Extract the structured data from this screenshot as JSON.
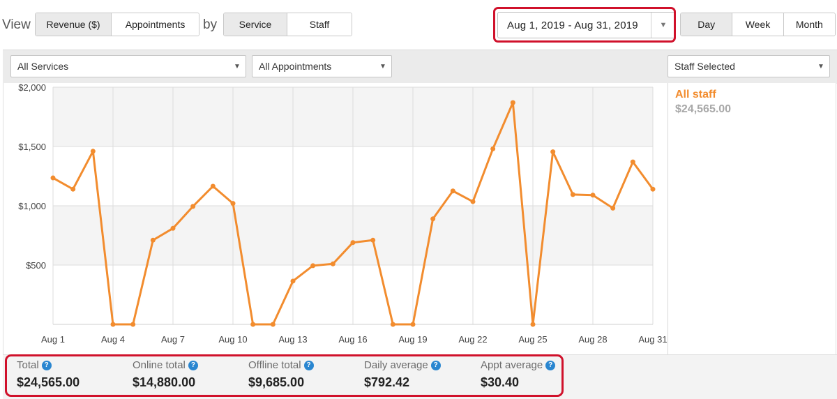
{
  "toolbar": {
    "view_label": "View",
    "by_label": "by",
    "metric_buttons": [
      "Revenue ($)",
      "Appointments"
    ],
    "group_buttons": [
      "Service",
      "Staff"
    ],
    "date_range": "Aug 1, 2019 - Aug 31, 2019",
    "period_buttons": [
      "Day",
      "Week",
      "Month"
    ]
  },
  "filters": {
    "services": "All Services",
    "appointments": "All Appointments",
    "staff": "Staff Selected"
  },
  "legend": {
    "name": "All staff",
    "value": "$24,565.00"
  },
  "totals": [
    {
      "label": "Total",
      "value": "$24,565.00"
    },
    {
      "label": "Online total",
      "value": "$14,880.00"
    },
    {
      "label": "Offline total",
      "value": "$9,685.00"
    },
    {
      "label": "Daily average",
      "value": "$792.42"
    },
    {
      "label": "Appt average",
      "value": "$30.40"
    }
  ],
  "colors": {
    "series": "#f28c2e",
    "highlight": "#d0112b",
    "help": "#2a86d0"
  },
  "chart_data": {
    "type": "line",
    "ylim": [
      0,
      2000
    ],
    "y_ticks": [
      "$500",
      "$1,000",
      "$1,500",
      "$2,000"
    ],
    "y_tick_values": [
      500,
      1000,
      1500,
      2000
    ],
    "x_tick_labels": [
      "Aug 1",
      "Aug 4",
      "Aug 7",
      "Aug 10",
      "Aug 13",
      "Aug 16",
      "Aug 19",
      "Aug 22",
      "Aug 25",
      "Aug 28",
      "Aug 31"
    ],
    "x_tick_days": [
      1,
      4,
      7,
      10,
      13,
      16,
      19,
      22,
      25,
      28,
      31
    ],
    "x": [
      "Aug 1",
      "Aug 2",
      "Aug 3",
      "Aug 4",
      "Aug 5",
      "Aug 6",
      "Aug 7",
      "Aug 8",
      "Aug 9",
      "Aug 10",
      "Aug 11",
      "Aug 12",
      "Aug 13",
      "Aug 14",
      "Aug 15",
      "Aug 16",
      "Aug 17",
      "Aug 18",
      "Aug 19",
      "Aug 20",
      "Aug 21",
      "Aug 22",
      "Aug 23",
      "Aug 24",
      "Aug 25",
      "Aug 26",
      "Aug 27",
      "Aug 28",
      "Aug 29",
      "Aug 30",
      "Aug 31"
    ],
    "series": [
      {
        "name": "All staff",
        "values": [
          1235,
          1140,
          1460,
          0,
          0,
          710,
          810,
          995,
          1165,
          1020,
          0,
          0,
          365,
          495,
          510,
          690,
          710,
          0,
          0,
          890,
          1125,
          1035,
          1480,
          1870,
          0,
          1455,
          1095,
          1090,
          980,
          1370,
          1140
        ]
      }
    ],
    "grid": true,
    "legend": "right"
  }
}
